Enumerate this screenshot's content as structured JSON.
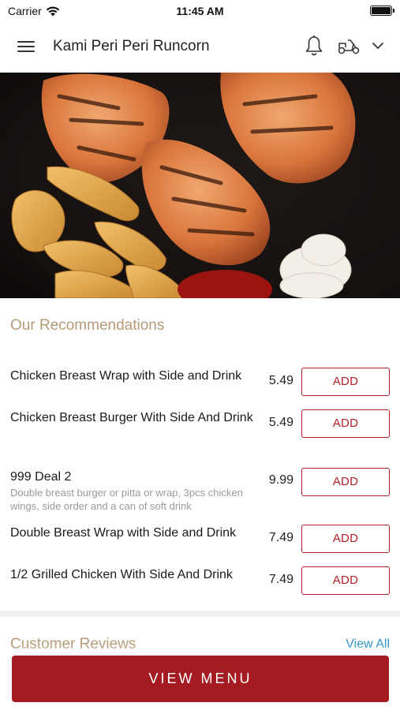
{
  "status_bar": {
    "carrier": "Carrier",
    "time": "11:45 AM"
  },
  "header": {
    "title": "Kami Peri Peri Runcorn"
  },
  "recommendations": {
    "title": "Our Recommendations",
    "add_label": "ADD",
    "items": [
      {
        "name": "Chicken Breast Wrap with Side and Drink",
        "price": "5.49",
        "description": ""
      },
      {
        "name": "Chicken Breast Burger With Side And Drink",
        "price": "5.49",
        "description": ""
      },
      {
        "name": "999 Deal 2",
        "price": "9.99",
        "description": "Double breast burger or pitta or wrap, 3pcs chicken wings, side order and a can of soft drink"
      },
      {
        "name": "Double Breast Wrap with Side and Drink",
        "price": "7.49",
        "description": ""
      },
      {
        "name": "1/2 Grilled Chicken With Side And Drink",
        "price": "7.49",
        "description": ""
      }
    ]
  },
  "reviews": {
    "title": "Customer Reviews",
    "view_all": "View All"
  },
  "footer": {
    "view_menu": "VIEW MENU"
  },
  "colors": {
    "accent": "#a51b22",
    "section_title": "#b59a77",
    "link": "#2f92c6"
  }
}
